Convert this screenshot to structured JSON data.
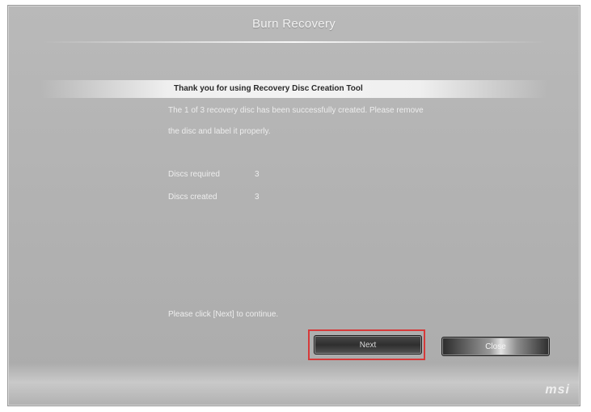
{
  "window": {
    "title": "Burn Recovery"
  },
  "content": {
    "header": "Thank you for using Recovery Disc Creation Tool",
    "message_line1": "The 1 of 3 recovery disc has been successfully created. Please remove",
    "message_line2": "the disc and label it properly.",
    "stats": [
      {
        "label": "Discs required",
        "value": "3"
      },
      {
        "label": "Discs created",
        "value": "3"
      }
    ],
    "instruction": "Please click [Next] to continue."
  },
  "buttons": {
    "next_label": "Next",
    "close_label": "Close"
  },
  "brand": {
    "logo_text": "msi"
  },
  "colors": {
    "highlight_border": "#d63a3a"
  }
}
